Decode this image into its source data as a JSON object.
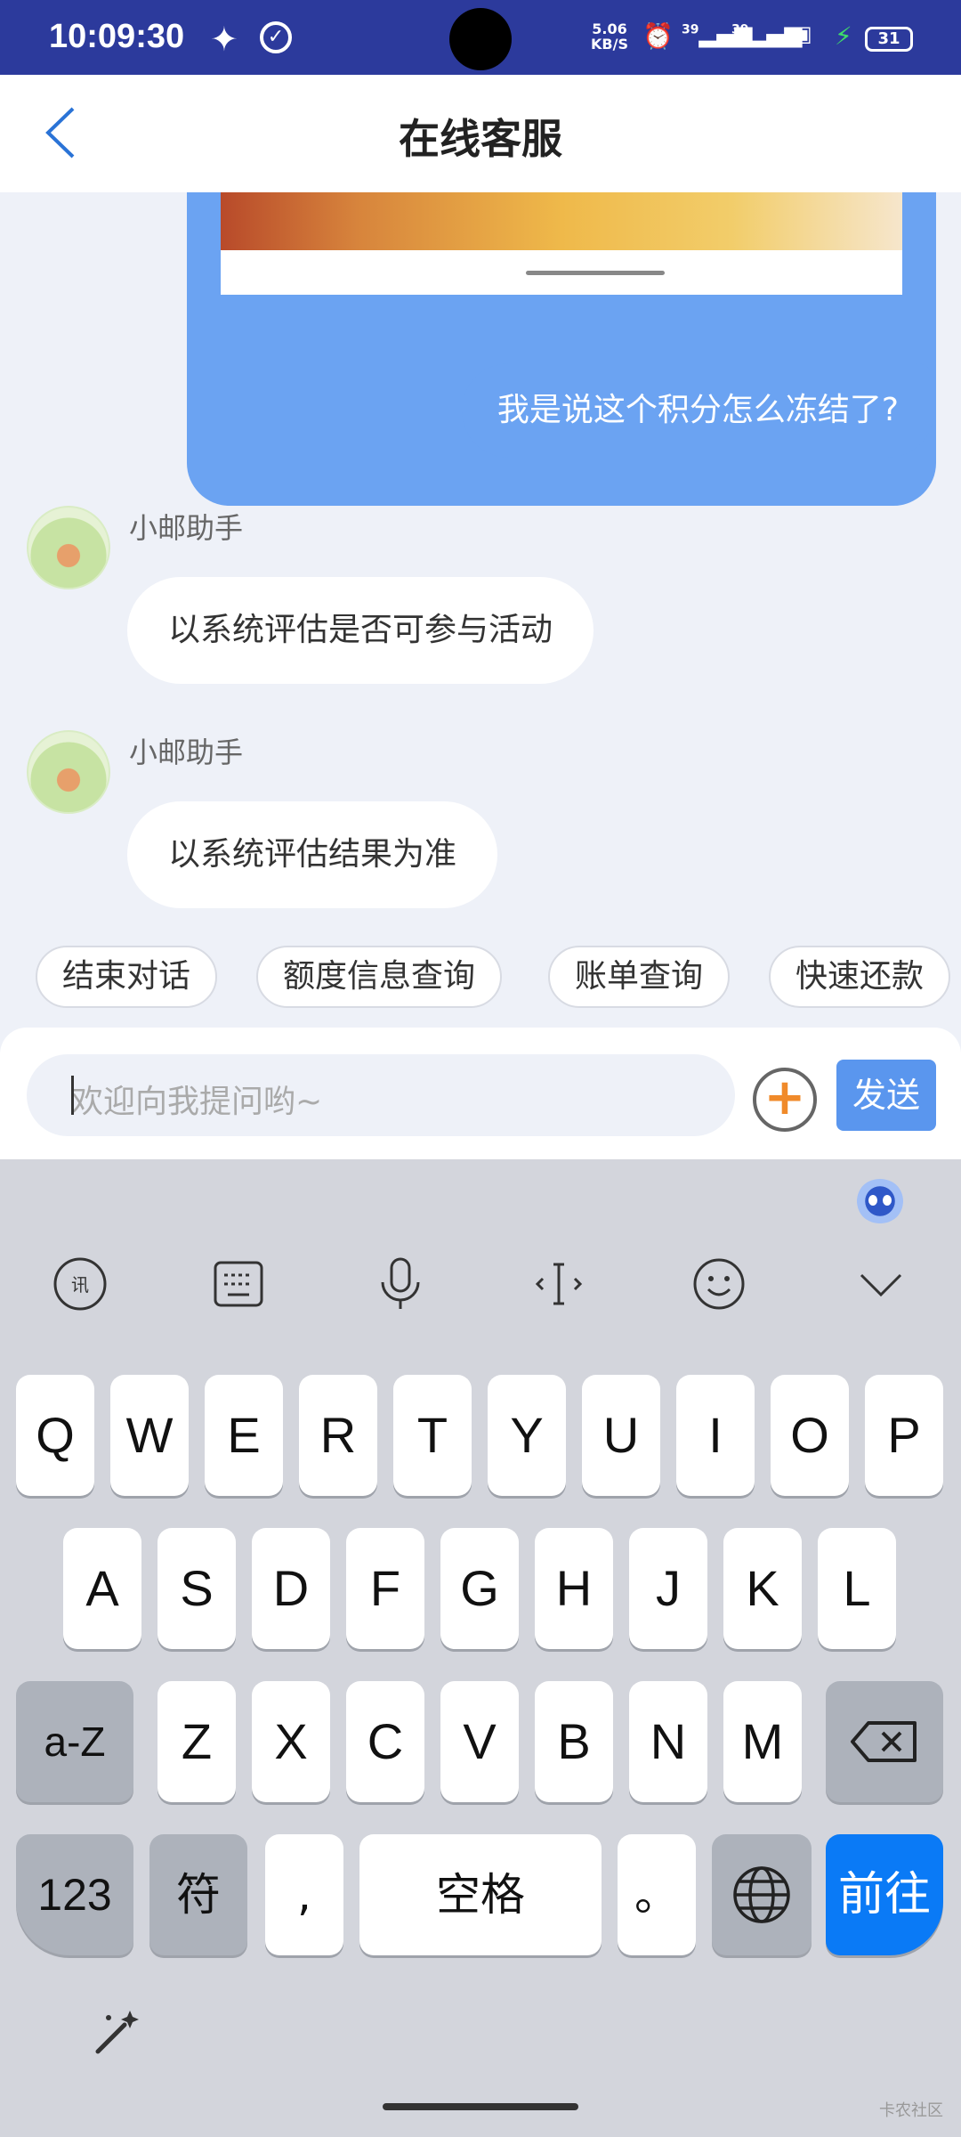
{
  "status_bar": {
    "time": "10:09:30",
    "net_speed_value": "5.06",
    "net_speed_unit": "KB/S",
    "signal1": "39",
    "signal2": "39",
    "battery": "31"
  },
  "header": {
    "title": "在线客服"
  },
  "chat": {
    "user_message": "我是说这个积分怎么冻结了?",
    "bot_messages": [
      {
        "sender": "小邮助手",
        "text": "以系统评估是否可参与活动"
      },
      {
        "sender": "小邮助手",
        "text": "以系统评估结果为准"
      }
    ],
    "quick_replies": [
      "结束对话",
      "额度信息查询",
      "账单查询",
      "快速还款"
    ]
  },
  "input": {
    "placeholder": "欢迎向我提问哟~",
    "send_label": "发送"
  },
  "keyboard": {
    "row1": [
      "Q",
      "W",
      "E",
      "R",
      "T",
      "Y",
      "U",
      "I",
      "O",
      "P"
    ],
    "row2": [
      "A",
      "S",
      "D",
      "F",
      "G",
      "H",
      "J",
      "K",
      "L"
    ],
    "row3": [
      "Z",
      "X",
      "C",
      "V",
      "B",
      "N",
      "M"
    ],
    "shift_label": "a-Z",
    "num_label": "123",
    "symbol_label": "符",
    "comma_label": ",",
    "space_label": "空格",
    "period_label": "。",
    "go_label": "前往"
  },
  "watermark": "卡农社区",
  "colors": {
    "status_bar": "#2c3a9c",
    "accent": "#5a96ee",
    "go_key": "#0a7af6"
  }
}
